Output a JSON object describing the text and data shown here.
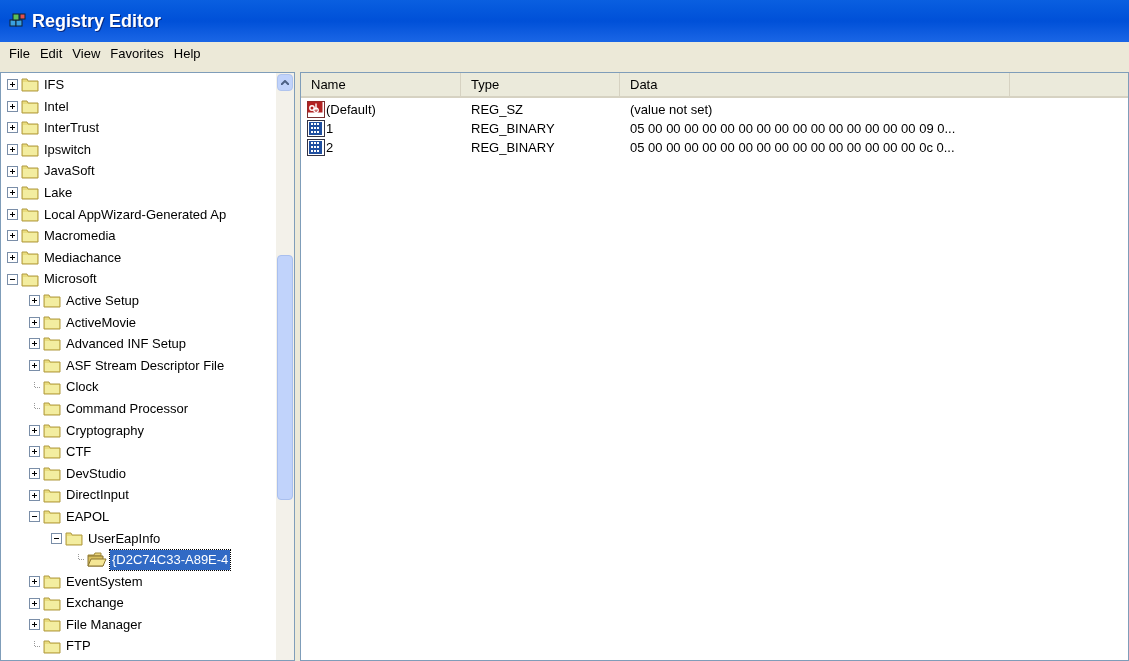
{
  "window": {
    "title": "Registry Editor"
  },
  "menu": [
    "File",
    "Edit",
    "View",
    "Favorites",
    "Help"
  ],
  "tree": [
    {
      "label": "IFS",
      "expandable": true,
      "selected": false
    },
    {
      "label": "Intel",
      "expandable": true,
      "selected": false
    },
    {
      "label": "InterTrust",
      "expandable": true,
      "selected": false
    },
    {
      "label": "Ipswitch",
      "expandable": true,
      "selected": false
    },
    {
      "label": "JavaSoft",
      "expandable": true,
      "selected": false
    },
    {
      "label": "Lake",
      "expandable": true,
      "selected": false
    },
    {
      "label": "Local AppWizard-Generated Ap",
      "expandable": true,
      "selected": false
    },
    {
      "label": "Macromedia",
      "expandable": true,
      "selected": false
    },
    {
      "label": "Mediachance",
      "expandable": true,
      "selected": false
    },
    {
      "label": "Microsoft",
      "expandable": true,
      "selected": false,
      "children": [
        {
          "label": "Active Setup",
          "expandable": true,
          "selected": false
        },
        {
          "label": "ActiveMovie",
          "expandable": true,
          "selected": false
        },
        {
          "label": "Advanced INF Setup",
          "expandable": true,
          "selected": false
        },
        {
          "label": "ASF Stream Descriptor File",
          "expandable": true,
          "selected": false
        },
        {
          "label": "Clock",
          "expandable": false,
          "selected": false
        },
        {
          "label": "Command Processor",
          "expandable": false,
          "selected": false
        },
        {
          "label": "Cryptography",
          "expandable": true,
          "selected": false
        },
        {
          "label": "CTF",
          "expandable": true,
          "selected": false
        },
        {
          "label": "DevStudio",
          "expandable": true,
          "selected": false
        },
        {
          "label": "DirectInput",
          "expandable": true,
          "selected": false
        },
        {
          "label": "EAPOL",
          "expandable": true,
          "selected": false,
          "children": [
            {
              "label": "UserEapInfo",
              "expandable": true,
              "selected": false,
              "children": [
                {
                  "label": "{D2C74C33-A89E-4",
                  "expandable": false,
                  "selected": true
                }
              ]
            }
          ]
        },
        {
          "label": "EventSystem",
          "expandable": true,
          "selected": false
        },
        {
          "label": "Exchange",
          "expandable": true,
          "selected": false
        },
        {
          "label": "File Manager",
          "expandable": true,
          "selected": false
        },
        {
          "label": "FTP",
          "expandable": false,
          "selected": false
        }
      ]
    }
  ],
  "table": {
    "columns": [
      "Name",
      "Type",
      "Data"
    ],
    "rows": [
      {
        "kind": "string",
        "name": "(Default)",
        "type": "REG_SZ",
        "data": "(value not set)"
      },
      {
        "kind": "binary",
        "name": "1",
        "type": "REG_BINARY",
        "data": "05 00 00 00 00 00 00 00 00 00 00 00 00 00 00 00 09 0..."
      },
      {
        "kind": "binary",
        "name": "2",
        "type": "REG_BINARY",
        "data": "05 00 00 00 00 00 00 00 00 00 00 00 00 00 00 00 0c 0..."
      }
    ]
  }
}
